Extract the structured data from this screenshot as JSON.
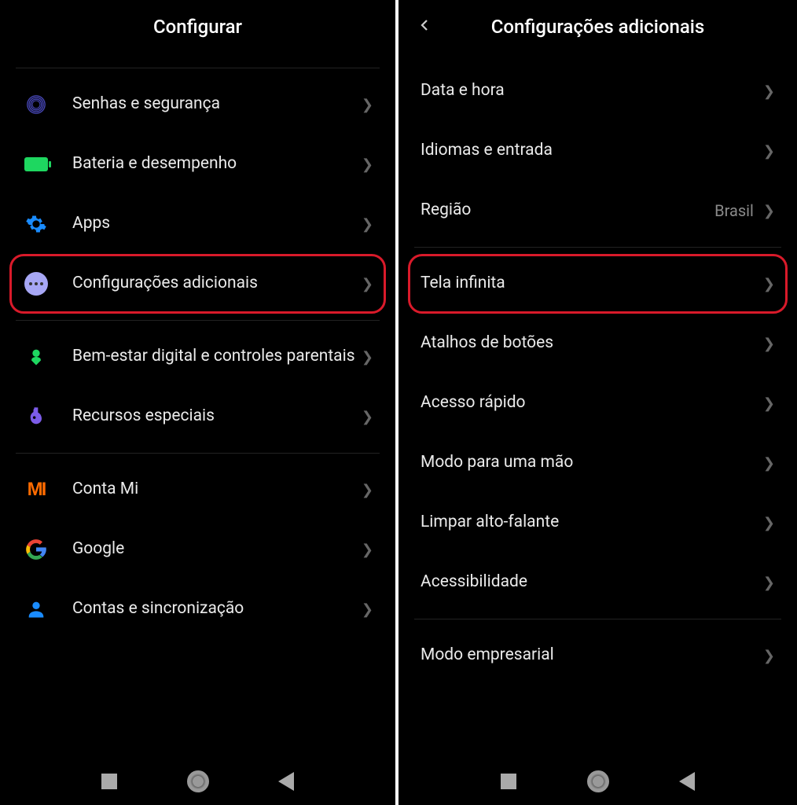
{
  "left": {
    "title": "Configurar",
    "items": [
      {
        "label": "Senhas e segurança",
        "icon": "fingerprint",
        "highlighted": false
      },
      {
        "label": "Bateria e desempenho",
        "icon": "battery",
        "highlighted": false
      },
      {
        "label": "Apps",
        "icon": "gear",
        "highlighted": false
      },
      {
        "label": "Configurações adicionais",
        "icon": "dots",
        "highlighted": true
      }
    ],
    "group2": [
      {
        "label": "Bem-estar digital e controles parentais",
        "icon": "heart"
      },
      {
        "label": "Recursos especiais",
        "icon": "flask"
      }
    ],
    "group3": [
      {
        "label": "Conta Mi",
        "icon": "mi"
      },
      {
        "label": "Google",
        "icon": "google"
      },
      {
        "label": "Contas e sincronização",
        "icon": "person"
      }
    ]
  },
  "right": {
    "title": "Configurações adicionais",
    "group1": [
      {
        "label": "Data e hora",
        "value": ""
      },
      {
        "label": "Idiomas e entrada",
        "value": ""
      },
      {
        "label": "Região",
        "value": "Brasil"
      }
    ],
    "group2": [
      {
        "label": "Tela infinita",
        "highlighted": true
      },
      {
        "label": "Atalhos de botões"
      },
      {
        "label": "Acesso rápido"
      },
      {
        "label": "Modo para uma mão"
      },
      {
        "label": "Limpar alto-falante"
      },
      {
        "label": "Acessibilidade"
      }
    ],
    "group3": [
      {
        "label": "Modo empresarial"
      }
    ]
  }
}
